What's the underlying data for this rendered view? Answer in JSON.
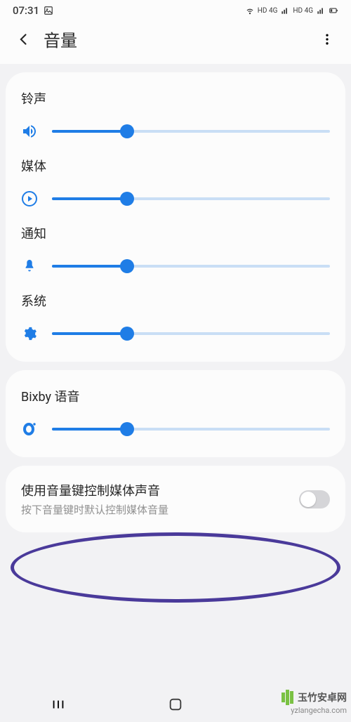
{
  "status_bar": {
    "time": "07:31",
    "indicators": {
      "net1": "HD 4G",
      "net2": "HD 4G"
    }
  },
  "header": {
    "title": "音量"
  },
  "volume_sections": [
    {
      "label": "铃声",
      "icon": "volume",
      "value": 27
    },
    {
      "label": "媒体",
      "icon": "play",
      "value": 27
    },
    {
      "label": "通知",
      "icon": "bell",
      "value": 27
    },
    {
      "label": "系统",
      "icon": "gear",
      "value": 27
    }
  ],
  "bixby": {
    "label": "Bixby 语音",
    "icon": "bixby",
    "value": 27
  },
  "toggle": {
    "title": "使用音量键控制媒体声音",
    "subtitle": "按下音量键时默认控制媒体音量",
    "on": false
  },
  "watermark": {
    "text": "玉竹安卓网",
    "url": "yzlangecha.com"
  }
}
